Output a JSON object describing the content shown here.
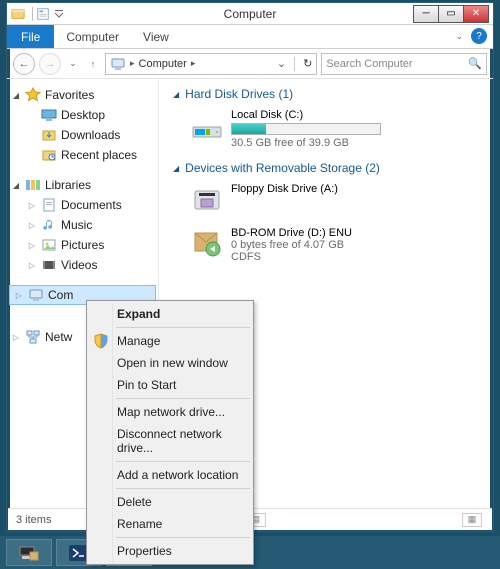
{
  "window": {
    "title": "Computer"
  },
  "ribbon": {
    "file": "File",
    "tabs": [
      "Computer",
      "View"
    ]
  },
  "address": {
    "up": "↑",
    "crumbs": [
      "Computer"
    ],
    "refresh": "↻",
    "down": "⌄"
  },
  "search": {
    "placeholder": "Search Computer"
  },
  "nav": {
    "favorites": {
      "label": "Favorites",
      "items": [
        "Desktop",
        "Downloads",
        "Recent places"
      ]
    },
    "libraries": {
      "label": "Libraries",
      "items": [
        "Documents",
        "Music",
        "Pictures",
        "Videos"
      ]
    },
    "computer": {
      "label": "Com"
    },
    "network": {
      "label": "Netw"
    }
  },
  "content": {
    "cat1": "Hard Disk Drives (1)",
    "drive1": {
      "name": "Local Disk (C:)",
      "free": "30.5 GB free of 39.9 GB",
      "fill_pct": 23
    },
    "cat2": "Devices with Removable Storage (2)",
    "drive2": {
      "name": "Floppy Disk Drive (A:)"
    },
    "drive3": {
      "name": "BD-ROM Drive (D:) ENU",
      "line2": "0 bytes free of 4.07 GB",
      "line3": "CDFS"
    }
  },
  "status": {
    "text": "3 items"
  },
  "context_menu": {
    "items": [
      "Expand",
      "Manage",
      "Open in new window",
      "Pin to Start",
      "Map network drive...",
      "Disconnect network drive...",
      "Add a network location",
      "Delete",
      "Rename",
      "Properties"
    ]
  }
}
